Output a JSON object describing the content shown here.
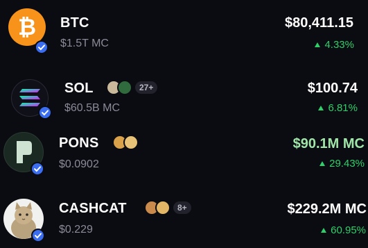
{
  "tokens": [
    {
      "symbol": "BTC",
      "market_cap": "$1.5T MC",
      "value": "$80,411.15",
      "change": "4.33%",
      "icon": "bitcoin-icon",
      "verified": true
    },
    {
      "symbol": "SOL",
      "market_cap": "$60.5B MC",
      "value": "$100.74",
      "change": "6.81%",
      "icon": "solana-icon",
      "verified": true,
      "holders_extra": "27+"
    },
    {
      "symbol": "PONS",
      "market_cap": "$0.0902",
      "value": "$90.1M MC",
      "change": "29.43%",
      "icon": "pons-icon",
      "verified": true
    },
    {
      "symbol": "CASHCAT",
      "market_cap": "$0.229",
      "value": "$229.2M MC",
      "change": "60.95%",
      "icon": "cat-icon",
      "verified": true,
      "holders_extra": "8+"
    }
  ],
  "colors": {
    "background": "#0b0b12",
    "positive": "#2fcf6a",
    "muted": "#8b8b98",
    "verified": "#3a6df0",
    "pons_value": "#9fe6a8",
    "btc": "#f7931a"
  }
}
